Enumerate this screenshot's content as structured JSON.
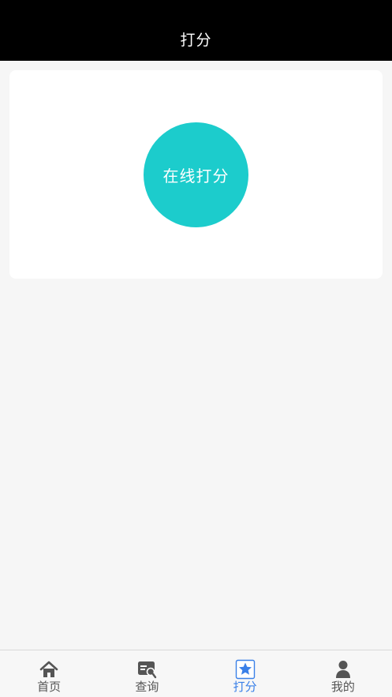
{
  "header": {
    "title": "打分"
  },
  "main": {
    "score_button_label": "在线打分"
  },
  "tabbar": {
    "items": [
      {
        "label": "首页",
        "icon": "home-icon",
        "active": false
      },
      {
        "label": "查询",
        "icon": "search-card-icon",
        "active": false
      },
      {
        "label": "打分",
        "icon": "star-icon",
        "active": true
      },
      {
        "label": "我的",
        "icon": "user-icon",
        "active": false
      }
    ]
  },
  "colors": {
    "nav_background": "#000000",
    "accent_teal": "#1ccccc",
    "tab_active": "#3a80e8",
    "tab_inactive": "#555555",
    "page_background": "#f6f6f6"
  }
}
